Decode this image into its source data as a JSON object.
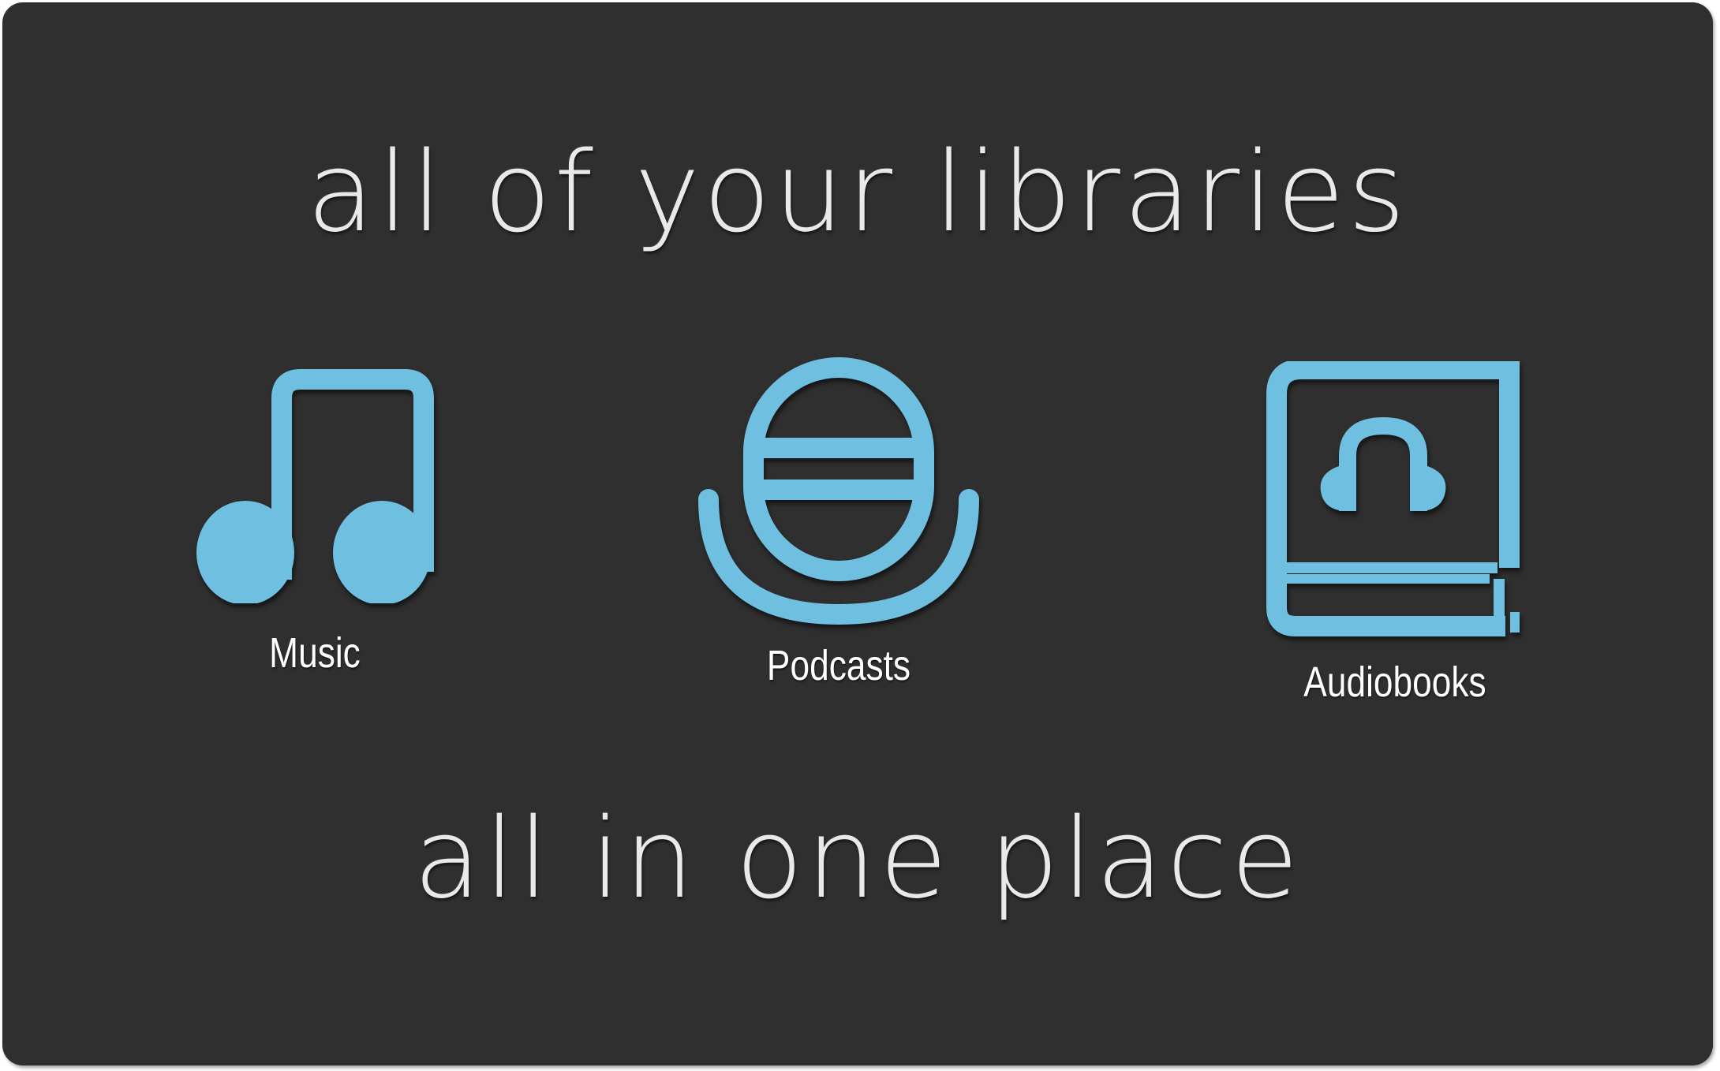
{
  "headline_top": "all of your libraries",
  "headline_bottom": "all in one place",
  "libraries": [
    {
      "label": "Music",
      "icon": "music-note-icon"
    },
    {
      "label": "Podcasts",
      "icon": "microphone-icon"
    },
    {
      "label": "Audiobooks",
      "icon": "audiobook-icon"
    }
  ],
  "colors": {
    "background": "#2f2f2f",
    "accent": "#6fc0e0",
    "headline": "#e9e9e9",
    "label": "#ffffff"
  }
}
